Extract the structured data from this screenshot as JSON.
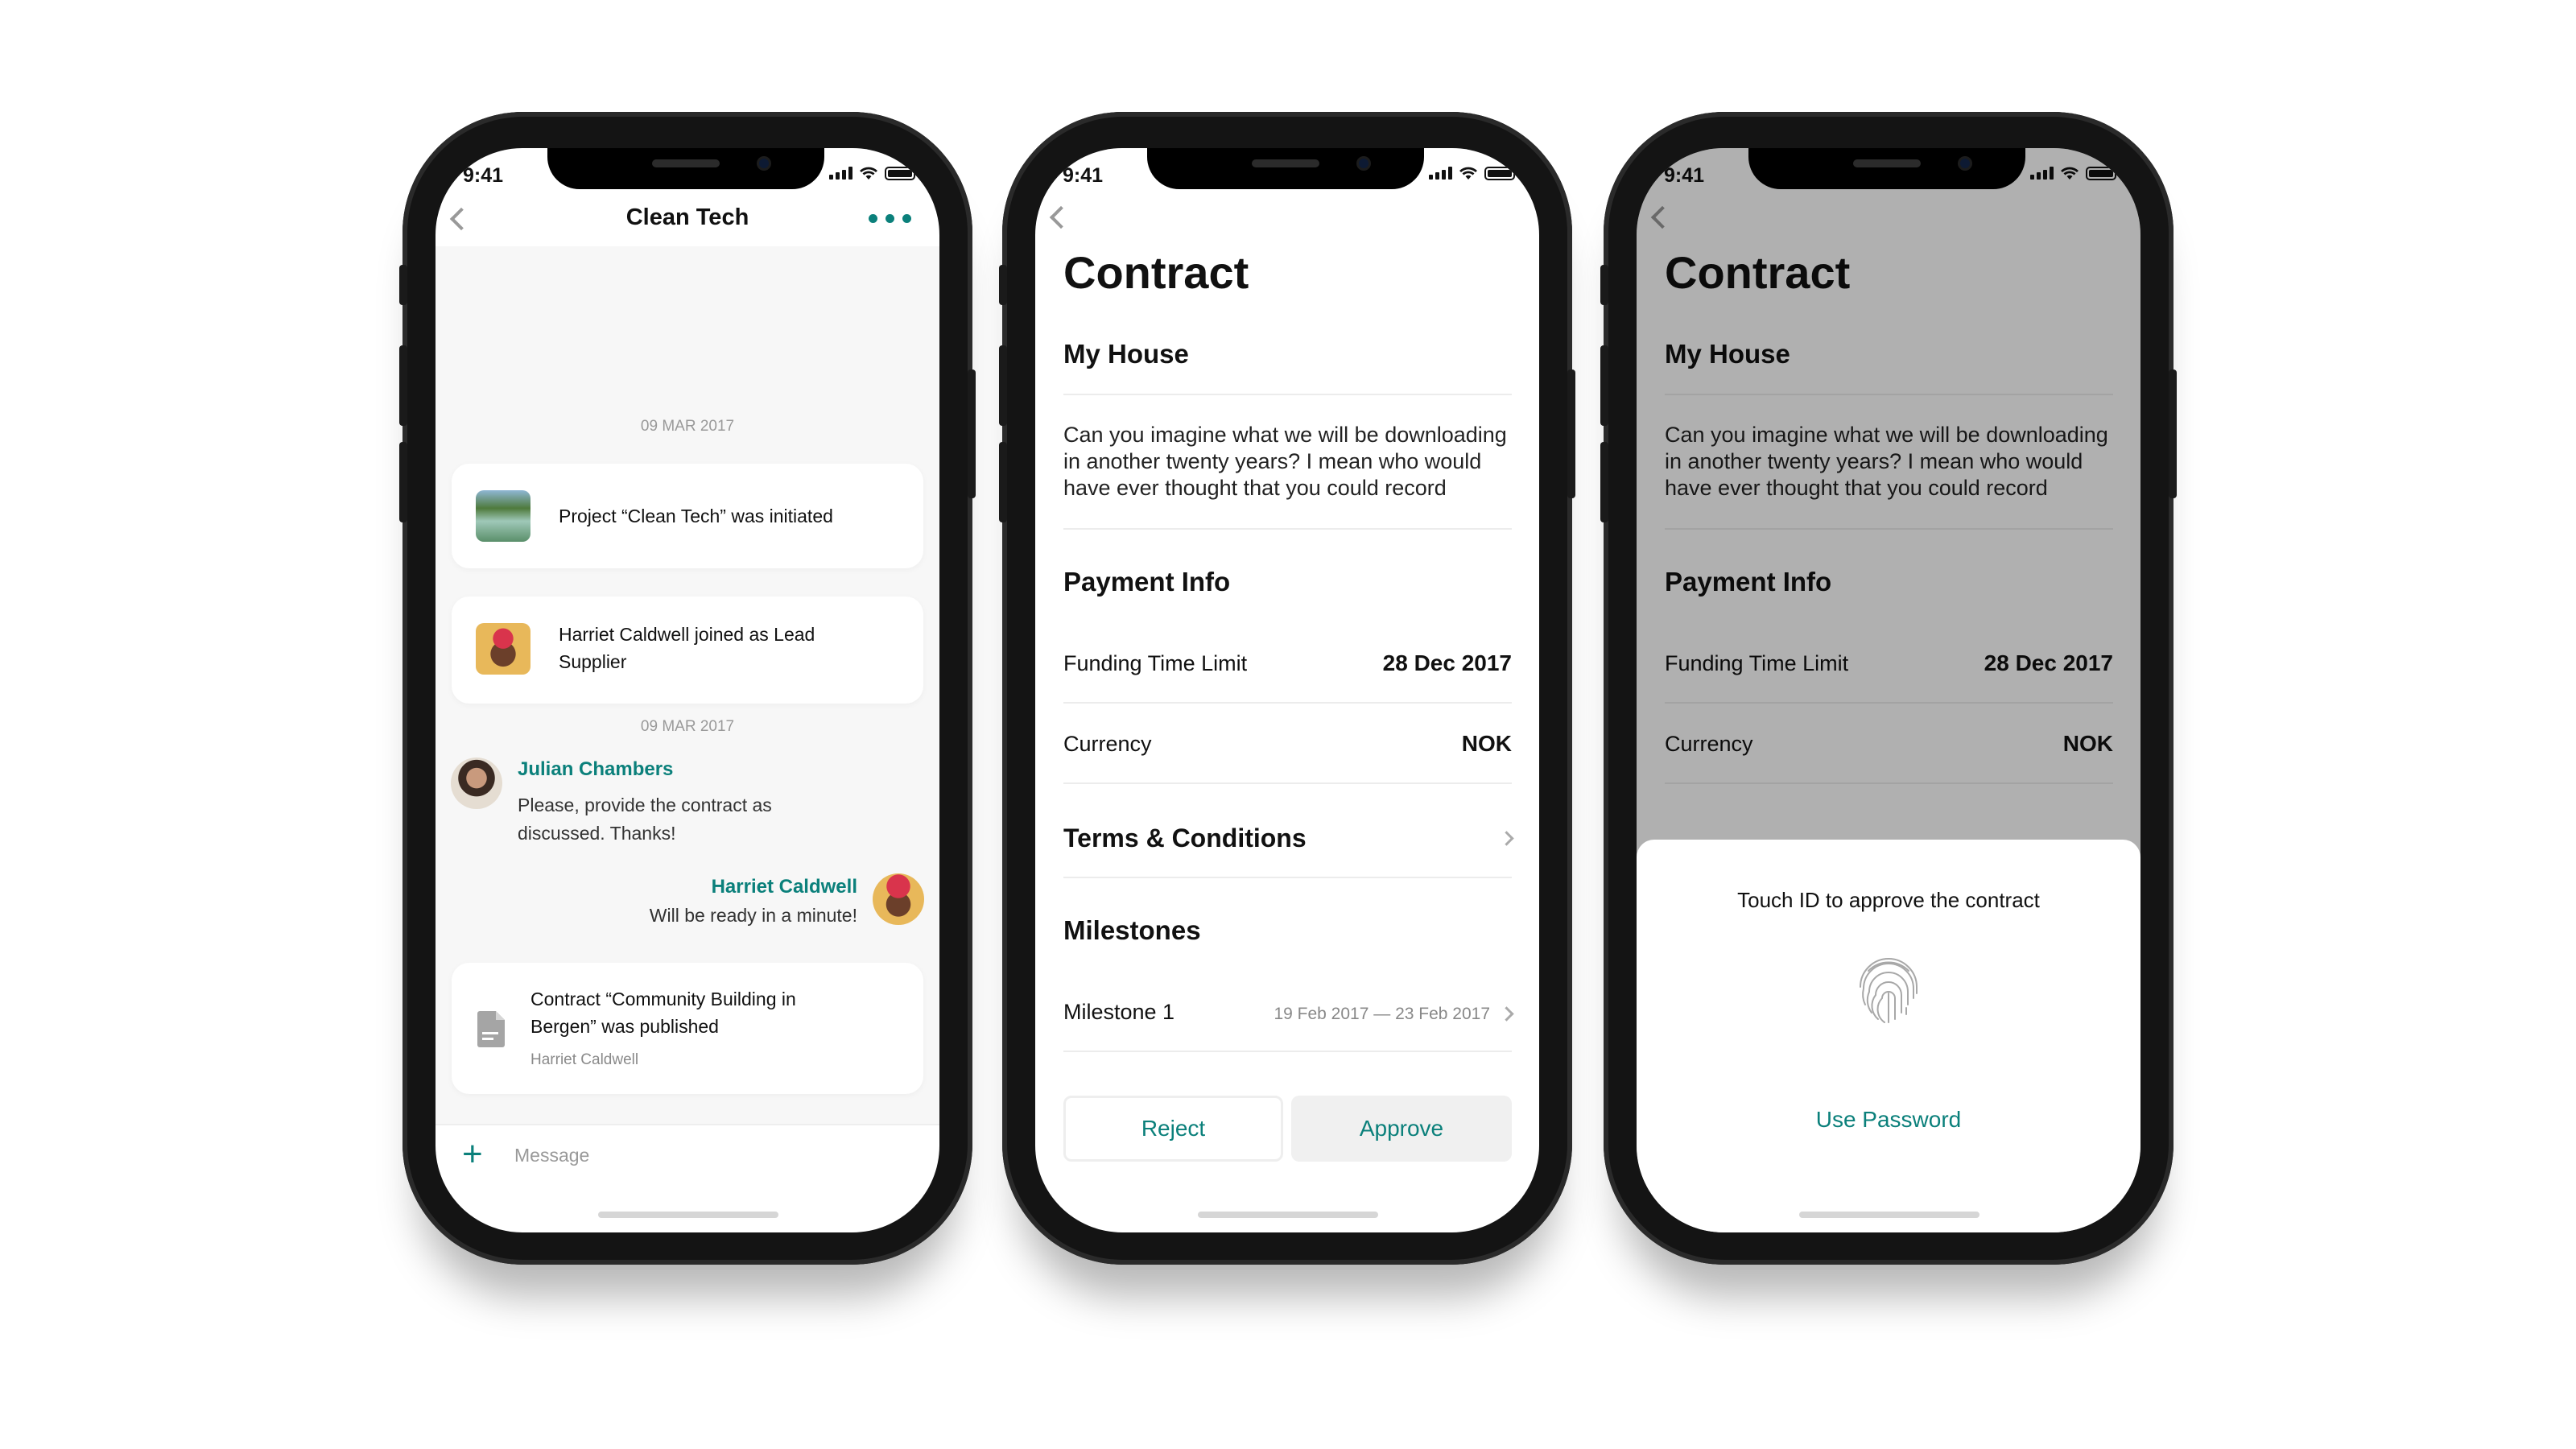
{
  "status_bar": {
    "time": "9:41"
  },
  "chat": {
    "title": "Clean Tech",
    "more_icon": "ellipsis-icon",
    "date_1": "09 MAR 2017",
    "event_1": "Project “Clean Tech” was initiated",
    "event_2": "Harriet Caldwell joined as Lead Supplier",
    "date_2": "09 MAR 2017",
    "messages": [
      {
        "sender": "Julian Chambers",
        "text": "Please, provide the contract as discussed. Thanks!"
      },
      {
        "sender": "Harriet Caldwell",
        "text": "Will be ready in a minute!"
      }
    ],
    "event_3": "Contract “Community Building in Bergen” was published",
    "event_3_author": "Harriet Caldwell",
    "input_placeholder": "Message"
  },
  "contract": {
    "title": "Contract",
    "subtitle": "My House",
    "description": "Can you imagine what we will be downloading in another twenty years? I mean who would have ever thought that you could record",
    "payment_header": "Payment Info",
    "funding_label": "Funding Time Limit",
    "funding_value": "28 Dec 2017",
    "currency_label": "Currency",
    "currency_value": "NOK",
    "terms_label": "Terms & Conditions",
    "milestones_header": "Milestones",
    "milestone_1_label": "Milestone 1",
    "milestone_1_dates": "19 Feb 2017 — 23 Feb 2017",
    "reject_label": "Reject",
    "approve_label": "Approve"
  },
  "touch_id": {
    "prompt": "Touch ID to approve the contract",
    "icon": "fingerprint-icon",
    "use_password_label": "Use Password"
  },
  "colors": {
    "accent": "#0b807b",
    "chat_bg": "#f7f7f7"
  }
}
